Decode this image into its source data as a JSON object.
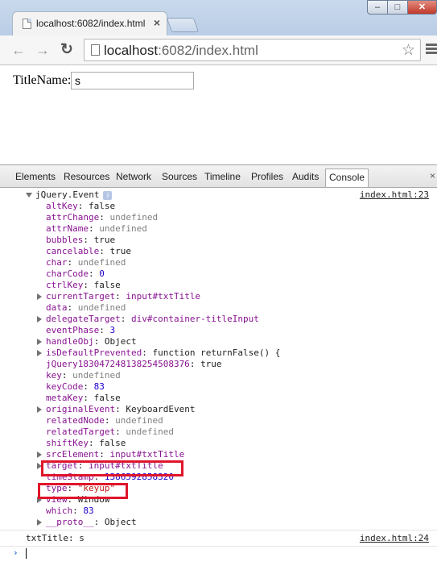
{
  "browser": {
    "tab_title": "localhost:6082/index.html",
    "url_host": "localhost",
    "url_rest": ":6082/index.html",
    "window_buttons": {
      "minimize": "‒",
      "maximize": "□",
      "close": "✕"
    }
  },
  "page": {
    "label": "TitleName:",
    "input_value": "s"
  },
  "devtools": {
    "tabs": [
      "Elements",
      "Resources",
      "Network",
      "Sources",
      "Timeline",
      "Profiles",
      "Audits",
      "Console"
    ],
    "active_tab": "Console",
    "object_header": "jQuery.Event",
    "header_source": "index.html:23",
    "properties": [
      {
        "key": "altKey",
        "value": "false",
        "type": "plain",
        "expandable": false
      },
      {
        "key": "attrChange",
        "value": "undefined",
        "type": "gray",
        "expandable": false
      },
      {
        "key": "attrName",
        "value": "undefined",
        "type": "gray",
        "expandable": false
      },
      {
        "key": "bubbles",
        "value": "true",
        "type": "plain",
        "expandable": false
      },
      {
        "key": "cancelable",
        "value": "true",
        "type": "plain",
        "expandable": false
      },
      {
        "key": "char",
        "value": "undefined",
        "type": "gray",
        "expandable": false
      },
      {
        "key": "charCode",
        "value": "0",
        "type": "number",
        "expandable": false
      },
      {
        "key": "ctrlKey",
        "value": "false",
        "type": "plain",
        "expandable": false
      },
      {
        "key": "currentTarget",
        "value": "input#txtTitle",
        "type": "node",
        "expandable": true
      },
      {
        "key": "data",
        "value": "undefined",
        "type": "gray",
        "expandable": false
      },
      {
        "key": "delegateTarget",
        "value": "div#container-titleInput",
        "type": "node",
        "expandable": true
      },
      {
        "key": "eventPhase",
        "value": "3",
        "type": "number",
        "expandable": false
      },
      {
        "key": "handleObj",
        "value": "Object",
        "type": "plain",
        "expandable": true
      },
      {
        "key": "isDefaultPrevented",
        "value": "function returnFalse() {",
        "type": "plain",
        "expandable": true
      },
      {
        "key": "jQuery183047248138254508376",
        "value": "true",
        "type": "plain",
        "expandable": false
      },
      {
        "key": "key",
        "value": "undefined",
        "type": "gray",
        "expandable": false
      },
      {
        "key": "keyCode",
        "value": "83",
        "type": "number",
        "expandable": false
      },
      {
        "key": "metaKey",
        "value": "false",
        "type": "plain",
        "expandable": false
      },
      {
        "key": "originalEvent",
        "value": "KeyboardEvent",
        "type": "plain",
        "expandable": true
      },
      {
        "key": "relatedNode",
        "value": "undefined",
        "type": "gray",
        "expandable": false
      },
      {
        "key": "relatedTarget",
        "value": "undefined",
        "type": "gray",
        "expandable": false
      },
      {
        "key": "shiftKey",
        "value": "false",
        "type": "plain",
        "expandable": false
      },
      {
        "key": "srcElement",
        "value": "input#txtTitle",
        "type": "node",
        "expandable": true
      },
      {
        "key": "target",
        "value": "input#txtTitle",
        "type": "node",
        "expandable": true,
        "highlighted": true
      },
      {
        "key": "timeStamp",
        "value": "1386592858320",
        "type": "number",
        "expandable": false
      },
      {
        "key": "type",
        "value": "\"keyup\"",
        "type": "string",
        "expandable": false,
        "highlighted": true
      },
      {
        "key": "view",
        "value": "Window",
        "type": "plain",
        "expandable": true
      },
      {
        "key": "which",
        "value": "83",
        "type": "number",
        "expandable": false
      },
      {
        "key": "__proto__",
        "value": "Object",
        "type": "plain",
        "expandable": true
      }
    ],
    "log_line": "txtTitle: s",
    "log_source": "index.html:24",
    "prompt_symbol": "›"
  },
  "colors": {
    "highlight": "#e0152b",
    "property_name": "#881391",
    "string": "#c41a16",
    "number": "#1c00cf"
  }
}
